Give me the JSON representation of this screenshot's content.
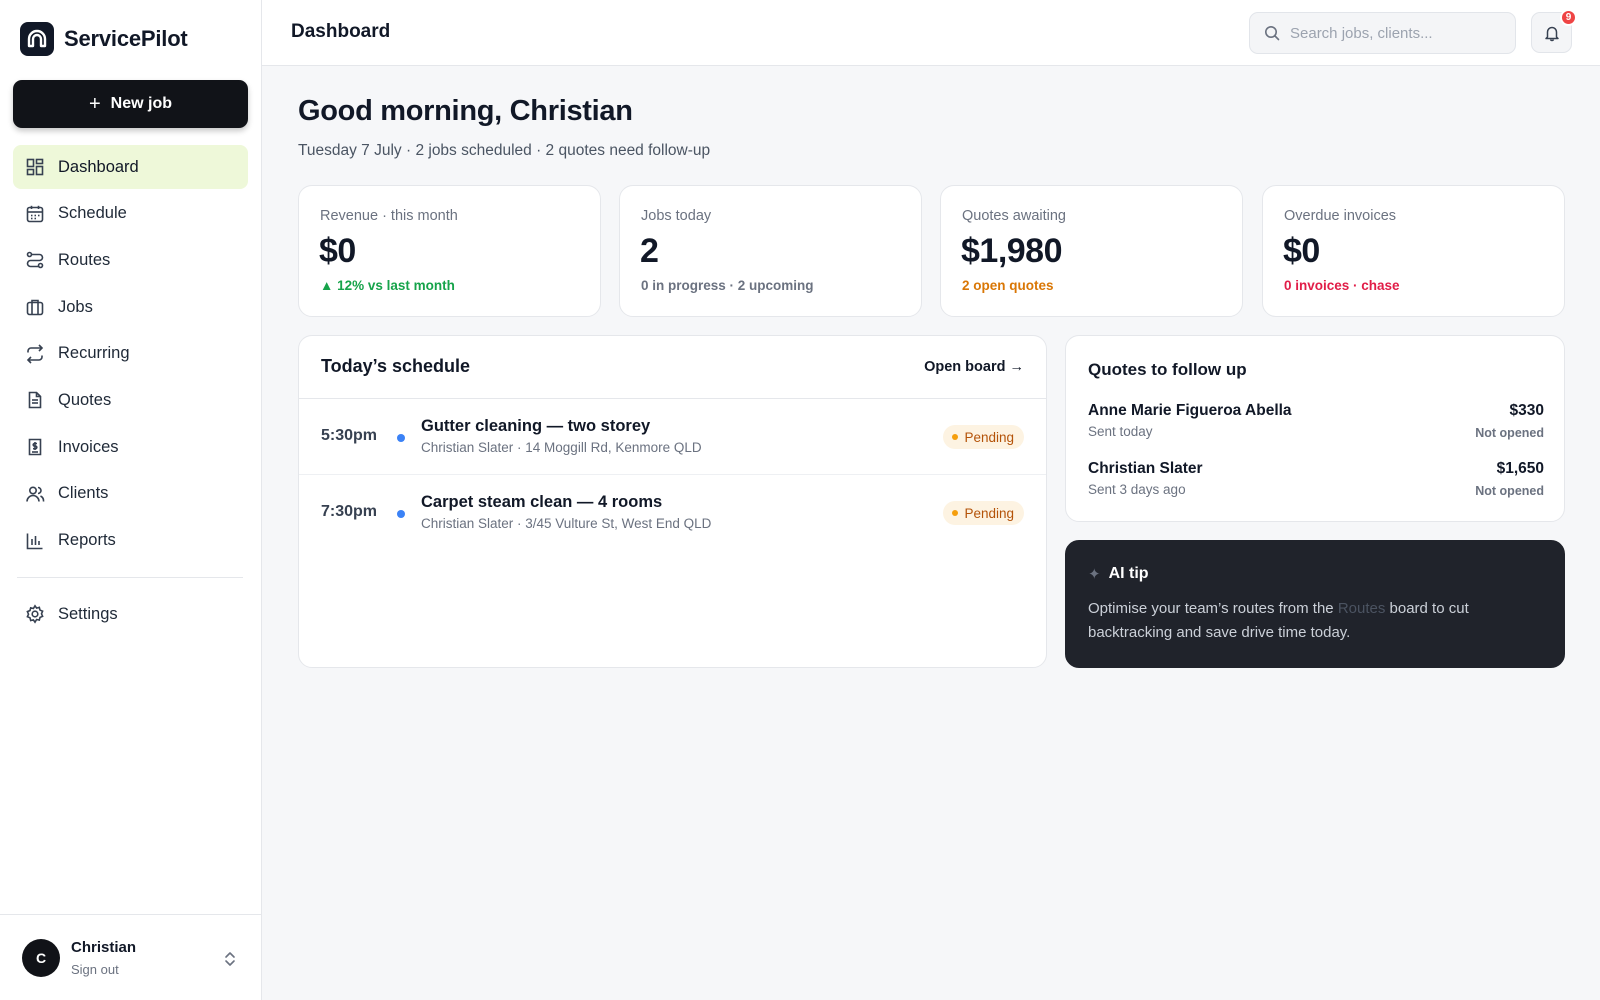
{
  "app": {
    "name": "ServicePilot"
  },
  "sidebar": {
    "new_job_label": "New job",
    "items": [
      {
        "label": "Dashboard",
        "icon": "grid-icon",
        "active": true
      },
      {
        "label": "Schedule",
        "icon": "calendar-icon"
      },
      {
        "label": "Routes",
        "icon": "route-icon"
      },
      {
        "label": "Jobs",
        "icon": "briefcase-icon"
      },
      {
        "label": "Recurring",
        "icon": "repeat-icon"
      },
      {
        "label": "Quotes",
        "icon": "document-icon"
      },
      {
        "label": "Invoices",
        "icon": "invoice-icon"
      },
      {
        "label": "Clients",
        "icon": "users-icon"
      },
      {
        "label": "Reports",
        "icon": "bar-chart-icon"
      }
    ],
    "settings_label": "Settings",
    "user": {
      "initial": "C",
      "name": "Christian",
      "sign_out": "Sign out"
    }
  },
  "topbar": {
    "title": "Dashboard",
    "search_placeholder": "Search jobs, clients...",
    "notification_count": "9"
  },
  "main": {
    "greeting": "Good morning, Christian",
    "subline": "Tuesday 7 July · 2 jobs scheduled · 2 quotes need follow-up",
    "stats": [
      {
        "label": "Revenue · this month",
        "value": "$0",
        "note": "▲ 12% vs last month",
        "note_color": "#16a34a"
      },
      {
        "label": "Jobs today",
        "value": "2",
        "note": "0 in progress · 2 upcoming",
        "note_color": "#6b7280"
      },
      {
        "label": "Quotes awaiting",
        "value": "$1,980",
        "note": "2 open quotes",
        "note_color": "#d97706"
      },
      {
        "label": "Overdue invoices",
        "value": "$0",
        "note": "0 invoices · chase",
        "note_color": "#e11d48"
      }
    ],
    "schedule": {
      "title": "Today’s schedule",
      "open_board": "Open board →",
      "rows": [
        {
          "time": "5:30pm",
          "title": "Gutter cleaning — two storey",
          "sub": "Christian Slater · 14 Moggill Rd, Kenmore QLD",
          "status": "Pending"
        },
        {
          "time": "7:30pm",
          "title": "Carpet steam clean — 4 rooms",
          "sub": "Christian Slater · 3/45 Vulture St, West End QLD",
          "status": "Pending"
        }
      ]
    },
    "quotes": {
      "title": "Quotes to follow up",
      "rows": [
        {
          "name": "Anne Marie Figueroa Abella",
          "sent": "Sent today",
          "amount": "$330",
          "status": "Not opened"
        },
        {
          "name": "Christian Slater",
          "sent": "Sent 3 days ago",
          "amount": "$1,650",
          "status": "Not opened"
        }
      ]
    },
    "tip": {
      "title": "AI tip",
      "before": "Optimise your team’s routes from the ",
      "link": "Routes",
      "after": " board to cut backtracking and save drive time today."
    }
  },
  "colors": {
    "accent_active": "#eef8d9",
    "dark": "#111318",
    "pending": "#f59e0b",
    "dot": "#3b82f6"
  }
}
